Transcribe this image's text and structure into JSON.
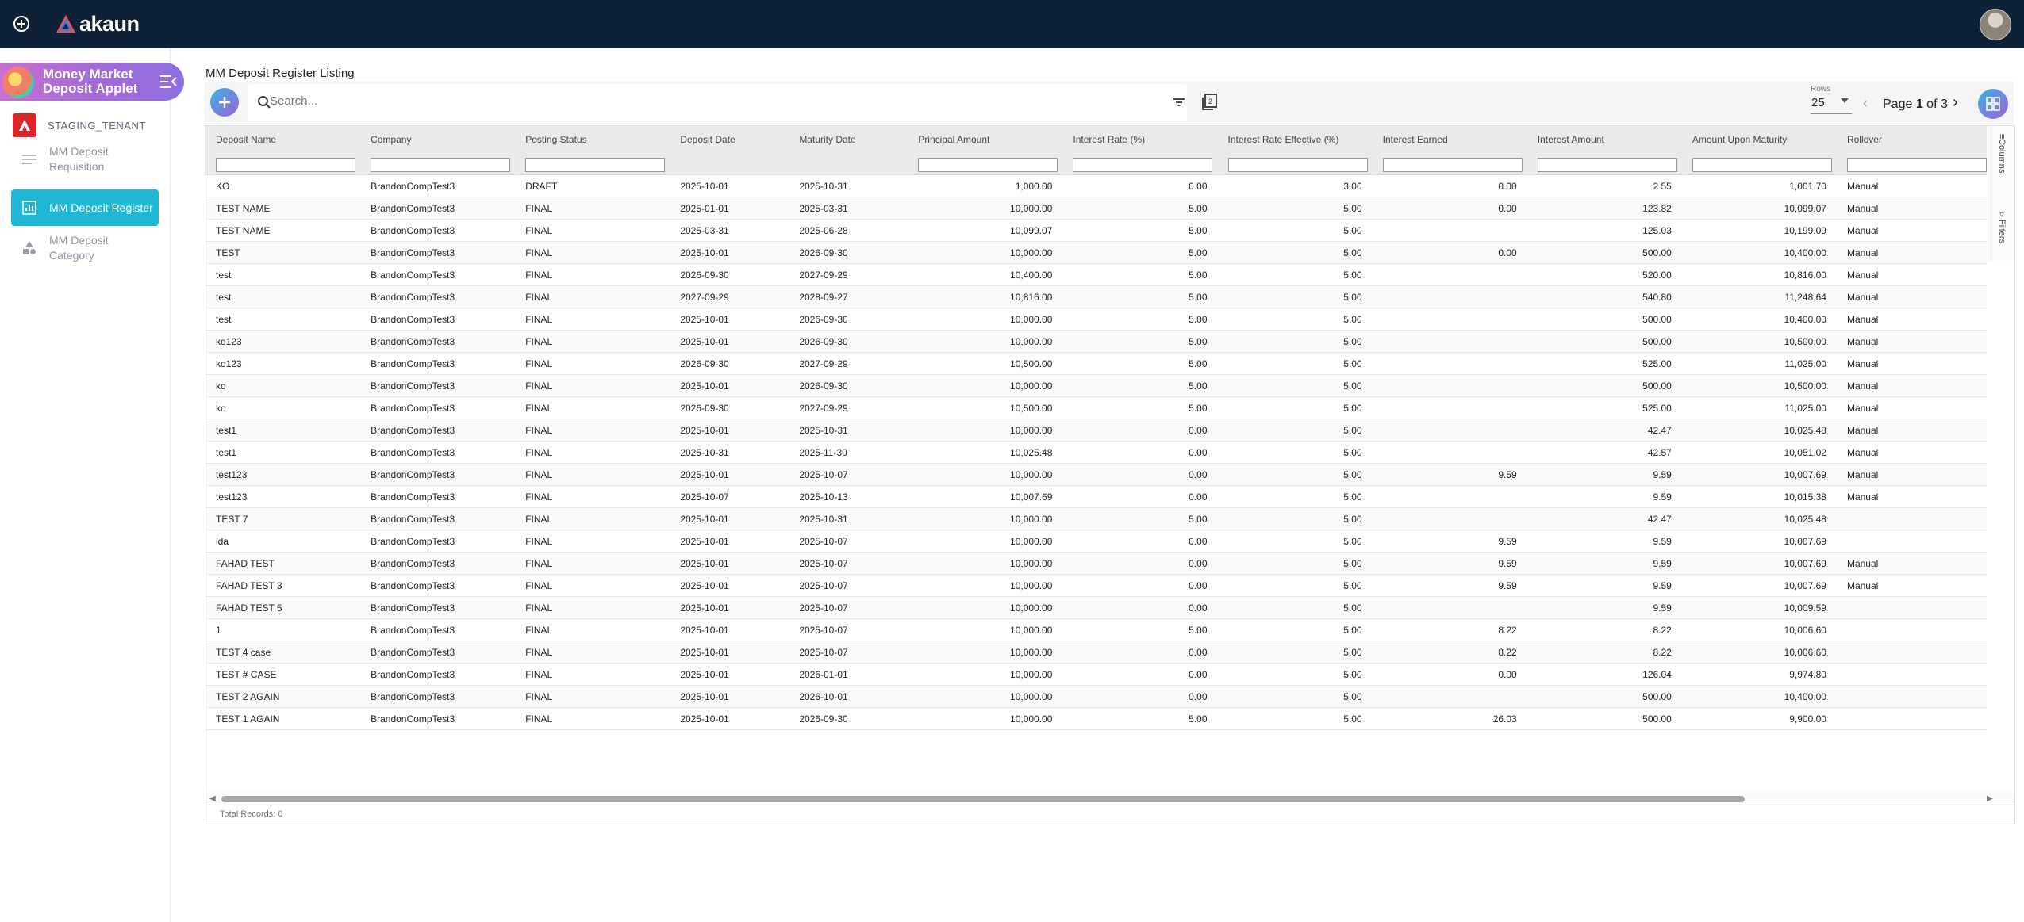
{
  "app": {
    "logo_text": "akaun",
    "applet_title": "Money Market Deposit Applet",
    "tenant": "STAGING_TENANT"
  },
  "sidebar": {
    "items": [
      {
        "label": "MM Deposit Requisition",
        "icon": "list-icon",
        "active": false
      },
      {
        "label": "MM Deposit Register",
        "icon": "chart-icon",
        "active": true
      },
      {
        "label": "MM Deposit Category",
        "icon": "shapes-icon",
        "active": false
      }
    ]
  },
  "main": {
    "title": "MM Deposit Register Listing",
    "search_placeholder": "Search...",
    "rows_label": "Rows",
    "rows_value": "25",
    "page_prefix": "Page ",
    "page_current": "1",
    "page_suffix": " of 3",
    "total_records": "Total Records: 0",
    "side_tabs": [
      "Columns",
      "Filters"
    ]
  },
  "grid": {
    "columns": [
      "Deposit Name",
      "Company",
      "Posting Status",
      "Deposit Date",
      "Maturity Date",
      "Principal Amount",
      "Interest Rate (%)",
      "Interest Rate Effective (%)",
      "Interest Earned",
      "Interest Amount",
      "Amount Upon Maturity",
      "Rollover"
    ],
    "filter_columns": [
      true,
      true,
      true,
      false,
      false,
      true,
      true,
      true,
      true,
      true,
      true,
      true
    ],
    "rows": [
      [
        "KO",
        "BrandonCompTest3",
        "DRAFT",
        "2025-10-01",
        "2025-10-31",
        "1,000.00",
        "0.00",
        "3.00",
        "0.00",
        "2.55",
        "1,001.70",
        "Manual"
      ],
      [
        "TEST NAME",
        "BrandonCompTest3",
        "FINAL",
        "2025-01-01",
        "2025-03-31",
        "10,000.00",
        "5.00",
        "5.00",
        "0.00",
        "123.82",
        "10,099.07",
        "Manual"
      ],
      [
        "TEST NAME",
        "BrandonCompTest3",
        "FINAL",
        "2025-03-31",
        "2025-06-28",
        "10,099.07",
        "5.00",
        "5.00",
        "",
        "125.03",
        "10,199.09",
        "Manual"
      ],
      [
        "TEST",
        "BrandonCompTest3",
        "FINAL",
        "2025-10-01",
        "2026-09-30",
        "10,000.00",
        "5.00",
        "5.00",
        "0.00",
        "500.00",
        "10,400.00",
        "Manual"
      ],
      [
        "test",
        "BrandonCompTest3",
        "FINAL",
        "2026-09-30",
        "2027-09-29",
        "10,400.00",
        "5.00",
        "5.00",
        "",
        "520.00",
        "10,816.00",
        "Manual"
      ],
      [
        "test",
        "BrandonCompTest3",
        "FINAL",
        "2027-09-29",
        "2028-09-27",
        "10,816.00",
        "5.00",
        "5.00",
        "",
        "540.80",
        "11,248.64",
        "Manual"
      ],
      [
        "test",
        "BrandonCompTest3",
        "FINAL",
        "2025-10-01",
        "2026-09-30",
        "10,000.00",
        "5.00",
        "5.00",
        "",
        "500.00",
        "10,400.00",
        "Manual"
      ],
      [
        "ko123",
        "BrandonCompTest3",
        "FINAL",
        "2025-10-01",
        "2026-09-30",
        "10,000.00",
        "5.00",
        "5.00",
        "",
        "500.00",
        "10,500.00",
        "Manual"
      ],
      [
        "ko123",
        "BrandonCompTest3",
        "FINAL",
        "2026-09-30",
        "2027-09-29",
        "10,500.00",
        "5.00",
        "5.00",
        "",
        "525.00",
        "11,025.00",
        "Manual"
      ],
      [
        "ko",
        "BrandonCompTest3",
        "FINAL",
        "2025-10-01",
        "2026-09-30",
        "10,000.00",
        "5.00",
        "5.00",
        "",
        "500.00",
        "10,500.00",
        "Manual"
      ],
      [
        "ko",
        "BrandonCompTest3",
        "FINAL",
        "2026-09-30",
        "2027-09-29",
        "10,500.00",
        "5.00",
        "5.00",
        "",
        "525.00",
        "11,025.00",
        "Manual"
      ],
      [
        "test1",
        "BrandonCompTest3",
        "FINAL",
        "2025-10-01",
        "2025-10-31",
        "10,000.00",
        "0.00",
        "5.00",
        "",
        "42.47",
        "10,025.48",
        "Manual"
      ],
      [
        "test1",
        "BrandonCompTest3",
        "FINAL",
        "2025-10-31",
        "2025-11-30",
        "10,025.48",
        "0.00",
        "5.00",
        "",
        "42.57",
        "10,051.02",
        "Manual"
      ],
      [
        "test123",
        "BrandonCompTest3",
        "FINAL",
        "2025-10-01",
        "2025-10-07",
        "10,000.00",
        "0.00",
        "5.00",
        "9.59",
        "9.59",
        "10,007.69",
        "Manual"
      ],
      [
        "test123",
        "BrandonCompTest3",
        "FINAL",
        "2025-10-07",
        "2025-10-13",
        "10,007.69",
        "0.00",
        "5.00",
        "",
        "9.59",
        "10,015.38",
        "Manual"
      ],
      [
        "TEST 7",
        "BrandonCompTest3",
        "FINAL",
        "2025-10-01",
        "2025-10-31",
        "10,000.00",
        "5.00",
        "5.00",
        "",
        "42.47",
        "10,025.48",
        ""
      ],
      [
        "ida",
        "BrandonCompTest3",
        "FINAL",
        "2025-10-01",
        "2025-10-07",
        "10,000.00",
        "0.00",
        "5.00",
        "9.59",
        "9.59",
        "10,007.69",
        ""
      ],
      [
        "FAHAD TEST",
        "BrandonCompTest3",
        "FINAL",
        "2025-10-01",
        "2025-10-07",
        "10,000.00",
        "0.00",
        "5.00",
        "9.59",
        "9.59",
        "10,007.69",
        "Manual"
      ],
      [
        "FAHAD TEST 3",
        "BrandonCompTest3",
        "FINAL",
        "2025-10-01",
        "2025-10-07",
        "10,000.00",
        "0.00",
        "5.00",
        "9.59",
        "9.59",
        "10,007.69",
        "Manual"
      ],
      [
        "FAHAD TEST 5",
        "BrandonCompTest3",
        "FINAL",
        "2025-10-01",
        "2025-10-07",
        "10,000.00",
        "0.00",
        "5.00",
        "",
        "9.59",
        "10,009.59",
        ""
      ],
      [
        "1",
        "BrandonCompTest3",
        "FINAL",
        "2025-10-01",
        "2025-10-07",
        "10,000.00",
        "5.00",
        "5.00",
        "8.22",
        "8.22",
        "10,006.60",
        ""
      ],
      [
        "TEST 4 case",
        "BrandonCompTest3",
        "FINAL",
        "2025-10-01",
        "2025-10-07",
        "10,000.00",
        "0.00",
        "5.00",
        "8.22",
        "8.22",
        "10,006.60",
        ""
      ],
      [
        "TEST # CASE",
        "BrandonCompTest3",
        "FINAL",
        "2025-10-01",
        "2026-01-01",
        "10,000.00",
        "0.00",
        "5.00",
        "0.00",
        "126.04",
        "9,974.80",
        ""
      ],
      [
        "TEST 2 AGAIN",
        "BrandonCompTest3",
        "FINAL",
        "2025-10-01",
        "2026-10-01",
        "10,000.00",
        "0.00",
        "5.00",
        "",
        "500.00",
        "10,400.00",
        ""
      ],
      [
        "TEST 1 AGAIN",
        "BrandonCompTest3",
        "FINAL",
        "2025-10-01",
        "2026-09-30",
        "10,000.00",
        "5.00",
        "5.00",
        "26.03",
        "500.00",
        "9,900.00",
        ""
      ]
    ]
  }
}
